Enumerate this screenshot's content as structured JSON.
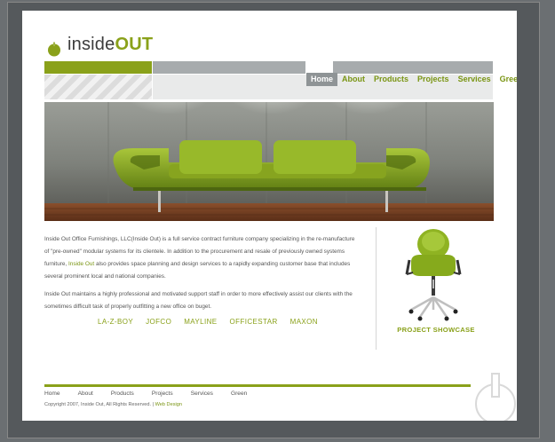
{
  "logo": {
    "word_plain": "inside",
    "word_bold": "OUT"
  },
  "nav": {
    "items": [
      {
        "label": "Home",
        "active": true
      },
      {
        "label": "About"
      },
      {
        "label": "Products"
      },
      {
        "label": "Projects"
      },
      {
        "label": "Services"
      },
      {
        "label": "Green"
      }
    ]
  },
  "intro": {
    "p1_a": "Inside Out Office Furnishings, LLC(Inside Out) is a full service contract furniture company specializing in the re-manufacture of \"pre-owned\" modular systems for its clientele. In addition to the procurement and resale of previously owned systems furniture,",
    "p1_link": "Inside Out",
    "p1_b": "also provides space planning and design services to a rapidly expanding customer base that includes several prominent local and national companies.",
    "p2": "Inside Out maintains a highly professional and motivated support staff in order to more effectively assist our clients with the sometimes difficult task of properly outfitting a new office on buget."
  },
  "brands": [
    "LA-Z-BOY",
    "JOFCO",
    "MAYLINE",
    "OFFICESTAR",
    "MAXON"
  ],
  "showcase": {
    "label": "PROJECT SHOWCASE"
  },
  "footer": {
    "links": [
      "Home",
      "About",
      "Products",
      "Projects",
      "Services",
      "Green"
    ],
    "copyright": "Copyright 2007, Inside Out, All Rights Reserved. |",
    "web_design": "Web Design"
  },
  "colors": {
    "accent": "#8aa11a",
    "gray_bar": "#a7abad",
    "nav_active": "#8f9496"
  }
}
